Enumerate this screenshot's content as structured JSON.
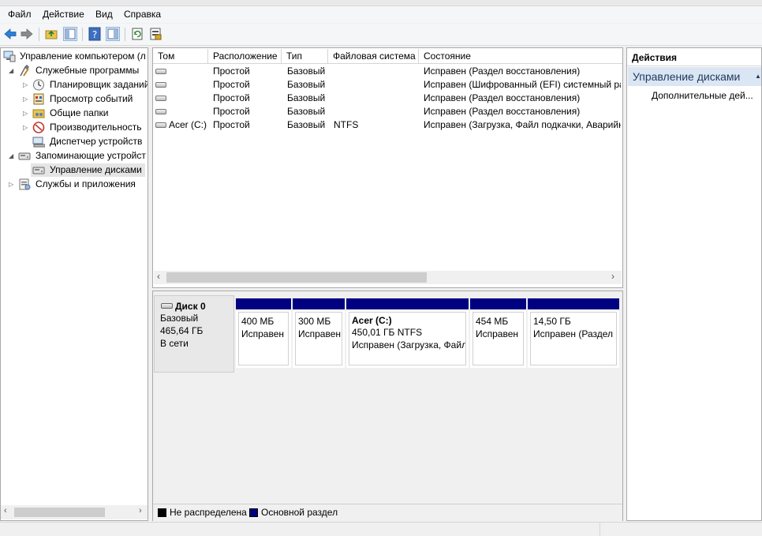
{
  "menu": {
    "items": [
      "Файл",
      "Действие",
      "Вид",
      "Справка"
    ]
  },
  "toolbar": {
    "icons": [
      "back-arrow-icon",
      "forward-arrow-icon",
      "up-folder-icon",
      "show-hide-tree-icon",
      "help-icon",
      "show-hide-action-pane-icon",
      "refresh-icon",
      "export-list-icon"
    ]
  },
  "tree": {
    "root": "Управление компьютером (л",
    "system_tools": "Служебные программы",
    "task_scheduler": "Планировщик заданий",
    "event_viewer": "Просмотр событий",
    "shared_folders": "Общие папки",
    "performance": "Производительность",
    "device_manager": "Диспетчер устройств",
    "storage": "Запоминающие устройст",
    "disk_management": "Управление дисками",
    "services_apps": "Службы и приложения"
  },
  "list": {
    "columns": [
      "Том",
      "Расположение",
      "Тип",
      "Файловая система",
      "Состояние"
    ],
    "rows": [
      {
        "volume": "",
        "layout": "Простой",
        "type": "Базовый",
        "fs": "",
        "status": "Исправен (Раздел восстановления)"
      },
      {
        "volume": "",
        "layout": "Простой",
        "type": "Базовый",
        "fs": "",
        "status": "Исправен (Шифрованный (EFI) системный ра"
      },
      {
        "volume": "",
        "layout": "Простой",
        "type": "Базовый",
        "fs": "",
        "status": "Исправен (Раздел восстановления)"
      },
      {
        "volume": "",
        "layout": "Простой",
        "type": "Базовый",
        "fs": "",
        "status": "Исправен (Раздел восстановления)"
      },
      {
        "volume": "Acer (C:)",
        "layout": "Простой",
        "type": "Базовый",
        "fs": "NTFS",
        "status": "Исправен (Загрузка, Файл подкачки, Аварийн"
      }
    ]
  },
  "disk": {
    "name": "Диск 0",
    "type": "Базовый",
    "size": "465,64 ГБ",
    "status": "В сети",
    "partitions": [
      {
        "title": "",
        "size": "400 МБ",
        "status": "Исправен"
      },
      {
        "title": "",
        "size": "300 МБ",
        "status": "Исправен"
      },
      {
        "title": "Acer  (C:)",
        "size": "450,01 ГБ NTFS",
        "status": "Исправен (Загрузка, Файл"
      },
      {
        "title": "",
        "size": "454 МБ",
        "status": "Исправен"
      },
      {
        "title": "",
        "size": "14,50 ГБ",
        "status": "Исправен (Раздел"
      }
    ]
  },
  "legend": {
    "unallocated": "Не распределена",
    "primary": "Основной раздел"
  },
  "colors": {
    "primary_partition": "#000080",
    "unallocated": "#000000",
    "selection": "#cce8ff",
    "actions_header": "#dbe6f4"
  },
  "actions": {
    "header": "Действия",
    "section": "Управление дисками",
    "more": "Дополнительные дей..."
  }
}
